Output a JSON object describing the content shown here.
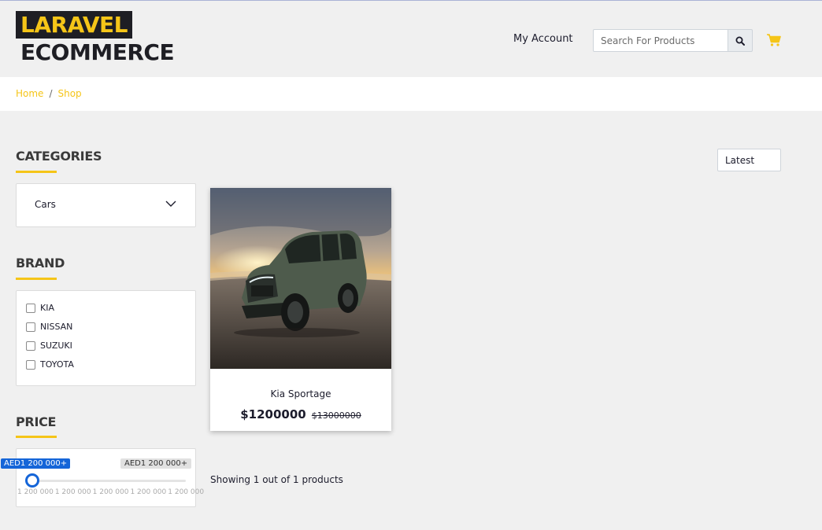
{
  "header": {
    "logo_top": "LARAVEL",
    "logo_bottom": "ECOMMERCE",
    "account_link": "My Account",
    "search_placeholder": "Search For Products",
    "search_icon": "search-icon",
    "cart_icon": "cart-icon"
  },
  "breadcrumb": {
    "items": [
      "Home",
      "Shop"
    ],
    "separator": "/"
  },
  "sidebar": {
    "categories_title": "CATEGORIES",
    "category_selected": "Cars",
    "brand_title": "BRAND",
    "brands": [
      "KIA",
      "NISSAN",
      "SUZUKI",
      "TOYOTA"
    ],
    "price_title": "PRICE",
    "price_min_label": "AED1 200 000+",
    "price_max_label": "AED1 200 000+",
    "price_ticks": [
      "1 200 000",
      "1 200 000",
      "1 200 000",
      "1 200 000",
      "1 200 000"
    ]
  },
  "sort": {
    "selected": "Latest"
  },
  "products": [
    {
      "name": "Kia Sportage",
      "price": "$1200000",
      "old_price": "$13000000",
      "image": "product-image-suv"
    }
  ],
  "results_text": "Showing 1 out of 1 products",
  "colors": {
    "accent": "#f5c518",
    "dark": "#1e1e24",
    "slider": "#1565d8",
    "background": "#f0f0f0"
  }
}
